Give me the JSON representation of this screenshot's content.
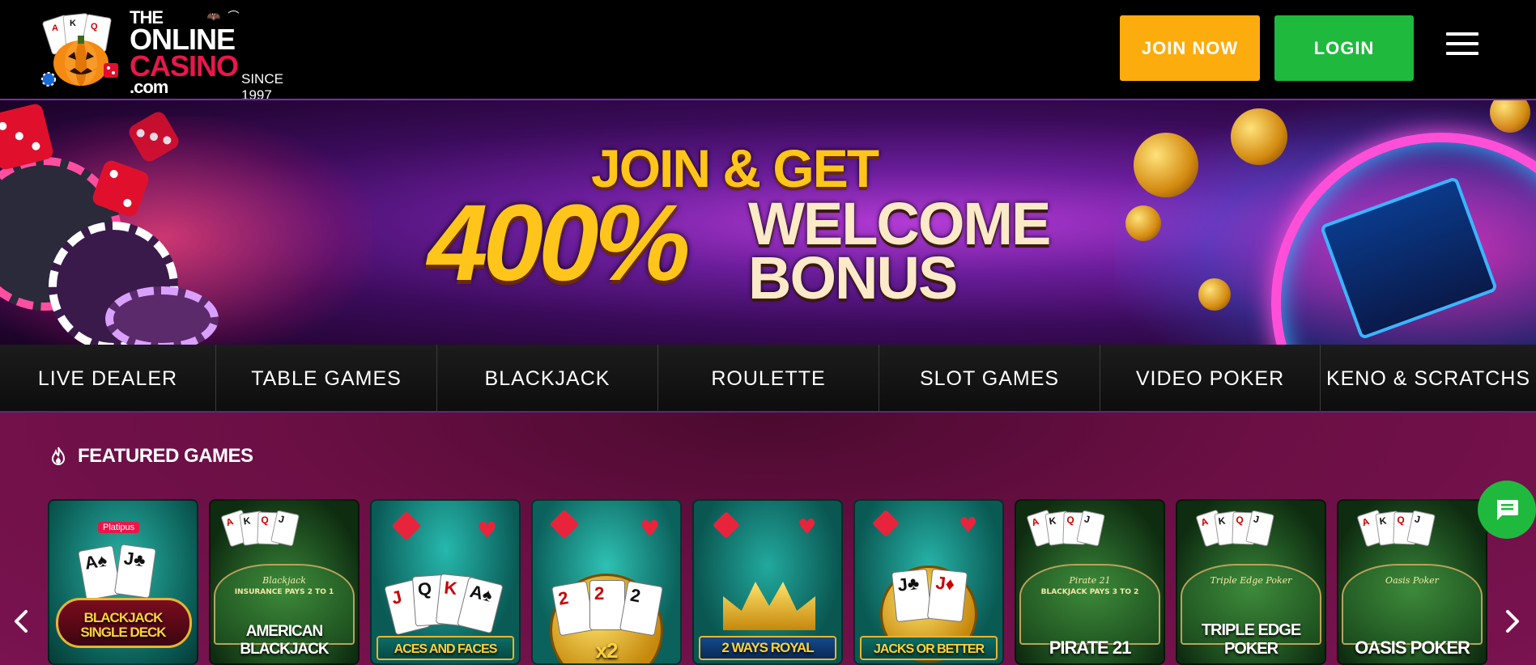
{
  "logo": {
    "line1": "THE",
    "line2": "ONLINE",
    "line3": "CASINO",
    "line4": ".com",
    "since": "SINCE 1997"
  },
  "header": {
    "join_label": "JOIN NOW",
    "login_label": "LOGIN",
    "colors": {
      "join": "#fdac0e",
      "login": "#1fba3d"
    }
  },
  "banner": {
    "line1": "JOIN & GET",
    "line2": "400%",
    "line3a": "WELCOME",
    "line3b": "BONUS"
  },
  "nav": {
    "items": [
      {
        "label": "LIVE DEALER"
      },
      {
        "label": "TABLE GAMES"
      },
      {
        "label": "BLACKJACK"
      },
      {
        "label": "ROULETTE"
      },
      {
        "label": "SLOT GAMES"
      },
      {
        "label": "VIDEO POKER"
      },
      {
        "label": "KENO & SCRATCHS"
      }
    ]
  },
  "featured": {
    "title": "FEATURED GAMES",
    "games": [
      {
        "name": "BLACKJACK SINGLE DECK",
        "badge": "Platipus",
        "style": "teal"
      },
      {
        "name": "AMERICAN BLACKJACK",
        "felt_label": "Blackjack",
        "felt_sub": "INSURANCE PAYS 2 TO 1",
        "style": "felt"
      },
      {
        "name": "ACES AND FACES",
        "style": "teal"
      },
      {
        "name": "x2",
        "style": "teal"
      },
      {
        "name": "2 WAYS ROYAL",
        "style": "teal"
      },
      {
        "name": "JACKS OR BETTER",
        "style": "teal"
      },
      {
        "name": "PIRATE 21",
        "felt_label": "Pirate 21",
        "felt_sub": "BLACKJACK PAYS 3 TO 2",
        "style": "felt"
      },
      {
        "name": "TRIPLE EDGE POKER",
        "felt_label": "Triple Edge Poker",
        "style": "felt"
      },
      {
        "name": "OASIS POKER",
        "felt_label": "Oasis Poker",
        "style": "felt"
      }
    ]
  }
}
